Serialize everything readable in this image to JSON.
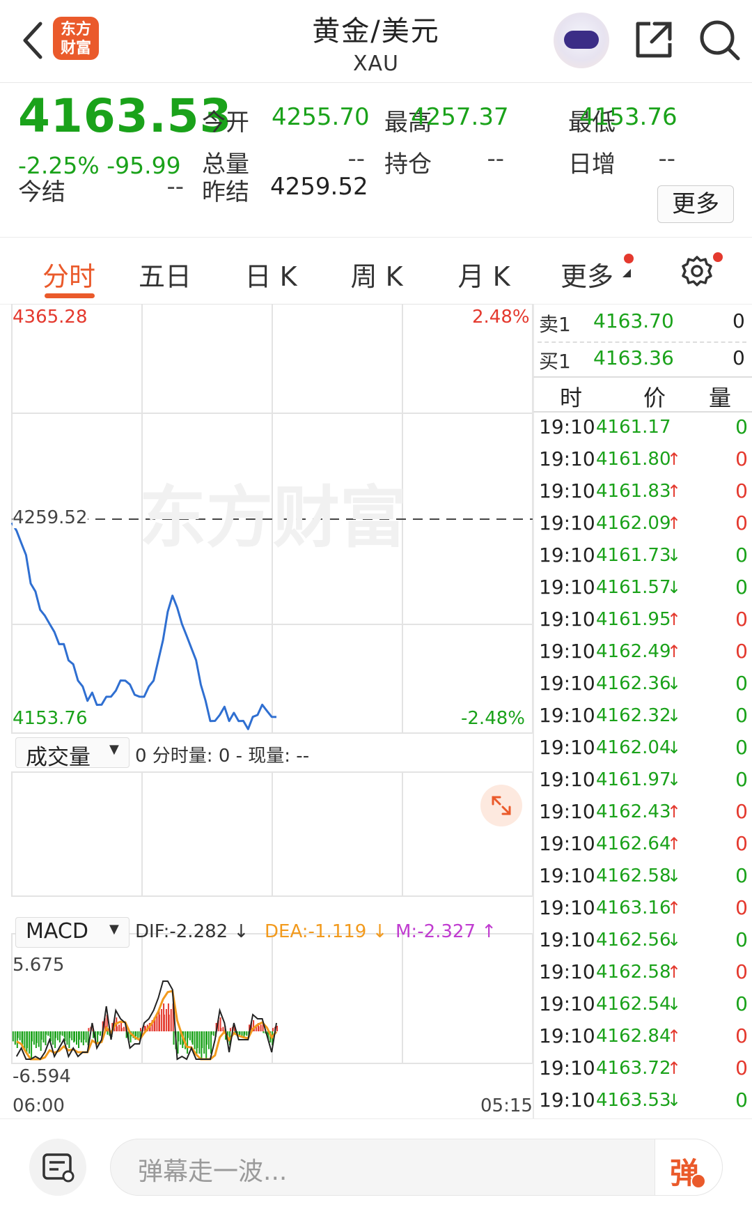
{
  "header": {
    "logo_line1": "东方",
    "logo_line2": "财富",
    "title": "黄金/美元",
    "subtitle": "XAU"
  },
  "quote": {
    "price": "4163.53",
    "change_pct": "-2.25%",
    "change_abs": "-95.99",
    "fields": [
      {
        "label": "今开",
        "value": "4255.70",
        "color": "green"
      },
      {
        "label": "最高",
        "value": "4257.37",
        "color": "green"
      },
      {
        "label": "最低",
        "value": "4153.76",
        "color": "green"
      },
      {
        "label": "总量",
        "value": "--",
        "color": "gray"
      },
      {
        "label": "持仓",
        "value": "--",
        "color": "gray"
      },
      {
        "label": "日增",
        "value": "--",
        "color": "gray"
      }
    ],
    "settle_label": "今结",
    "settle_value": "--",
    "prev_settle_label": "昨结",
    "prev_settle_value": "4259.52",
    "more_label": "更多"
  },
  "tabs": [
    "分时",
    "五日",
    "日 K",
    "周 K",
    "月 K",
    "更多"
  ],
  "active_tab": 0,
  "chart": {
    "y_max_label": "4365.28",
    "y_min_label": "4153.76",
    "pct_max_label": "2.48%",
    "pct_min_label": "-2.48%",
    "ref_label": "4259.52",
    "watermark": "东方财富",
    "volume_selector": "成交量",
    "volume_info": "0 分时量: 0 - 现量: --",
    "macd_selector": "MACD",
    "dif": "DIF:-2.282 ↓",
    "dea": "DEA:-1.119 ↓",
    "m": "M:-2.327 ↑",
    "macd_max": "5.675",
    "macd_min": "-6.594",
    "time_start": "06:00",
    "time_end": "05:15"
  },
  "chart_data": {
    "type": "line",
    "ylim": [
      4153.76,
      4365.28
    ],
    "reference": 4259.52,
    "series": [
      {
        "values": [
          4258,
          4252,
          4248,
          4240,
          4228,
          4222,
          4215,
          4210,
          4208,
          4202,
          4198,
          4196,
          4190,
          4186,
          4180,
          4175,
          4170,
          4172,
          4168,
          4166,
          4172,
          4170,
          4175,
          4178,
          4180,
          4176,
          4173,
          4170,
          4172,
          4175,
          4180,
          4188,
          4200,
          4212,
          4222,
          4214,
          4208,
          4200,
          4196,
          4188,
          4178,
          4168,
          4160,
          4158,
          4163,
          4165,
          4160,
          4162,
          4160,
          4158,
          4156,
          4160,
          4163,
          4166,
          4165,
          4160,
          4162
        ]
      }
    ],
    "macd_ylim": [
      -6.594,
      5.675
    ]
  },
  "orderbook": {
    "sell_label": "卖1",
    "sell_price": "4163.70",
    "sell_vol": "0",
    "buy_label": "买1",
    "buy_price": "4163.36",
    "buy_vol": "0",
    "col_time": "时",
    "col_price": "价",
    "col_vol": "量"
  },
  "ticks": [
    {
      "time": "19:10",
      "price": "4161.17",
      "arrow": "",
      "vol": "0",
      "dir": "flat"
    },
    {
      "time": "19:10",
      "price": "4161.80",
      "arrow": "↑",
      "vol": "0",
      "dir": "up"
    },
    {
      "time": "19:10",
      "price": "4161.83",
      "arrow": "↑",
      "vol": "0",
      "dir": "up"
    },
    {
      "time": "19:10",
      "price": "4162.09",
      "arrow": "↑",
      "vol": "0",
      "dir": "up"
    },
    {
      "time": "19:10",
      "price": "4161.73",
      "arrow": "↓",
      "vol": "0",
      "dir": "down"
    },
    {
      "time": "19:10",
      "price": "4161.57",
      "arrow": "↓",
      "vol": "0",
      "dir": "down"
    },
    {
      "time": "19:10",
      "price": "4161.95",
      "arrow": "↑",
      "vol": "0",
      "dir": "up"
    },
    {
      "time": "19:10",
      "price": "4162.49",
      "arrow": "↑",
      "vol": "0",
      "dir": "up"
    },
    {
      "time": "19:10",
      "price": "4162.36",
      "arrow": "↓",
      "vol": "0",
      "dir": "down"
    },
    {
      "time": "19:10",
      "price": "4162.32",
      "arrow": "↓",
      "vol": "0",
      "dir": "down"
    },
    {
      "time": "19:10",
      "price": "4162.04",
      "arrow": "↓",
      "vol": "0",
      "dir": "down"
    },
    {
      "time": "19:10",
      "price": "4161.97",
      "arrow": "↓",
      "vol": "0",
      "dir": "down"
    },
    {
      "time": "19:10",
      "price": "4162.43",
      "arrow": "↑",
      "vol": "0",
      "dir": "up"
    },
    {
      "time": "19:10",
      "price": "4162.64",
      "arrow": "↑",
      "vol": "0",
      "dir": "up"
    },
    {
      "time": "19:10",
      "price": "4162.58",
      "arrow": "↓",
      "vol": "0",
      "dir": "down"
    },
    {
      "time": "19:10",
      "price": "4163.16",
      "arrow": "↑",
      "vol": "0",
      "dir": "up"
    },
    {
      "time": "19:10",
      "price": "4162.56",
      "arrow": "↓",
      "vol": "0",
      "dir": "down"
    },
    {
      "time": "19:10",
      "price": "4162.58",
      "arrow": "↑",
      "vol": "0",
      "dir": "up"
    },
    {
      "time": "19:10",
      "price": "4162.54",
      "arrow": "↓",
      "vol": "0",
      "dir": "down"
    },
    {
      "time": "19:10",
      "price": "4162.84",
      "arrow": "↑",
      "vol": "0",
      "dir": "up"
    },
    {
      "time": "19:10",
      "price": "4163.72",
      "arrow": "↑",
      "vol": "0",
      "dir": "up"
    },
    {
      "time": "19:10",
      "price": "4163.53",
      "arrow": "↓",
      "vol": "0",
      "dir": "down"
    }
  ],
  "bottom": {
    "placeholder": "弹幕走一波...",
    "danmu_button": "弹"
  },
  "colors": {
    "up": "#e4392e",
    "down": "#1aa21a",
    "accent": "#ea5a2b",
    "line": "#2f6fd1"
  }
}
